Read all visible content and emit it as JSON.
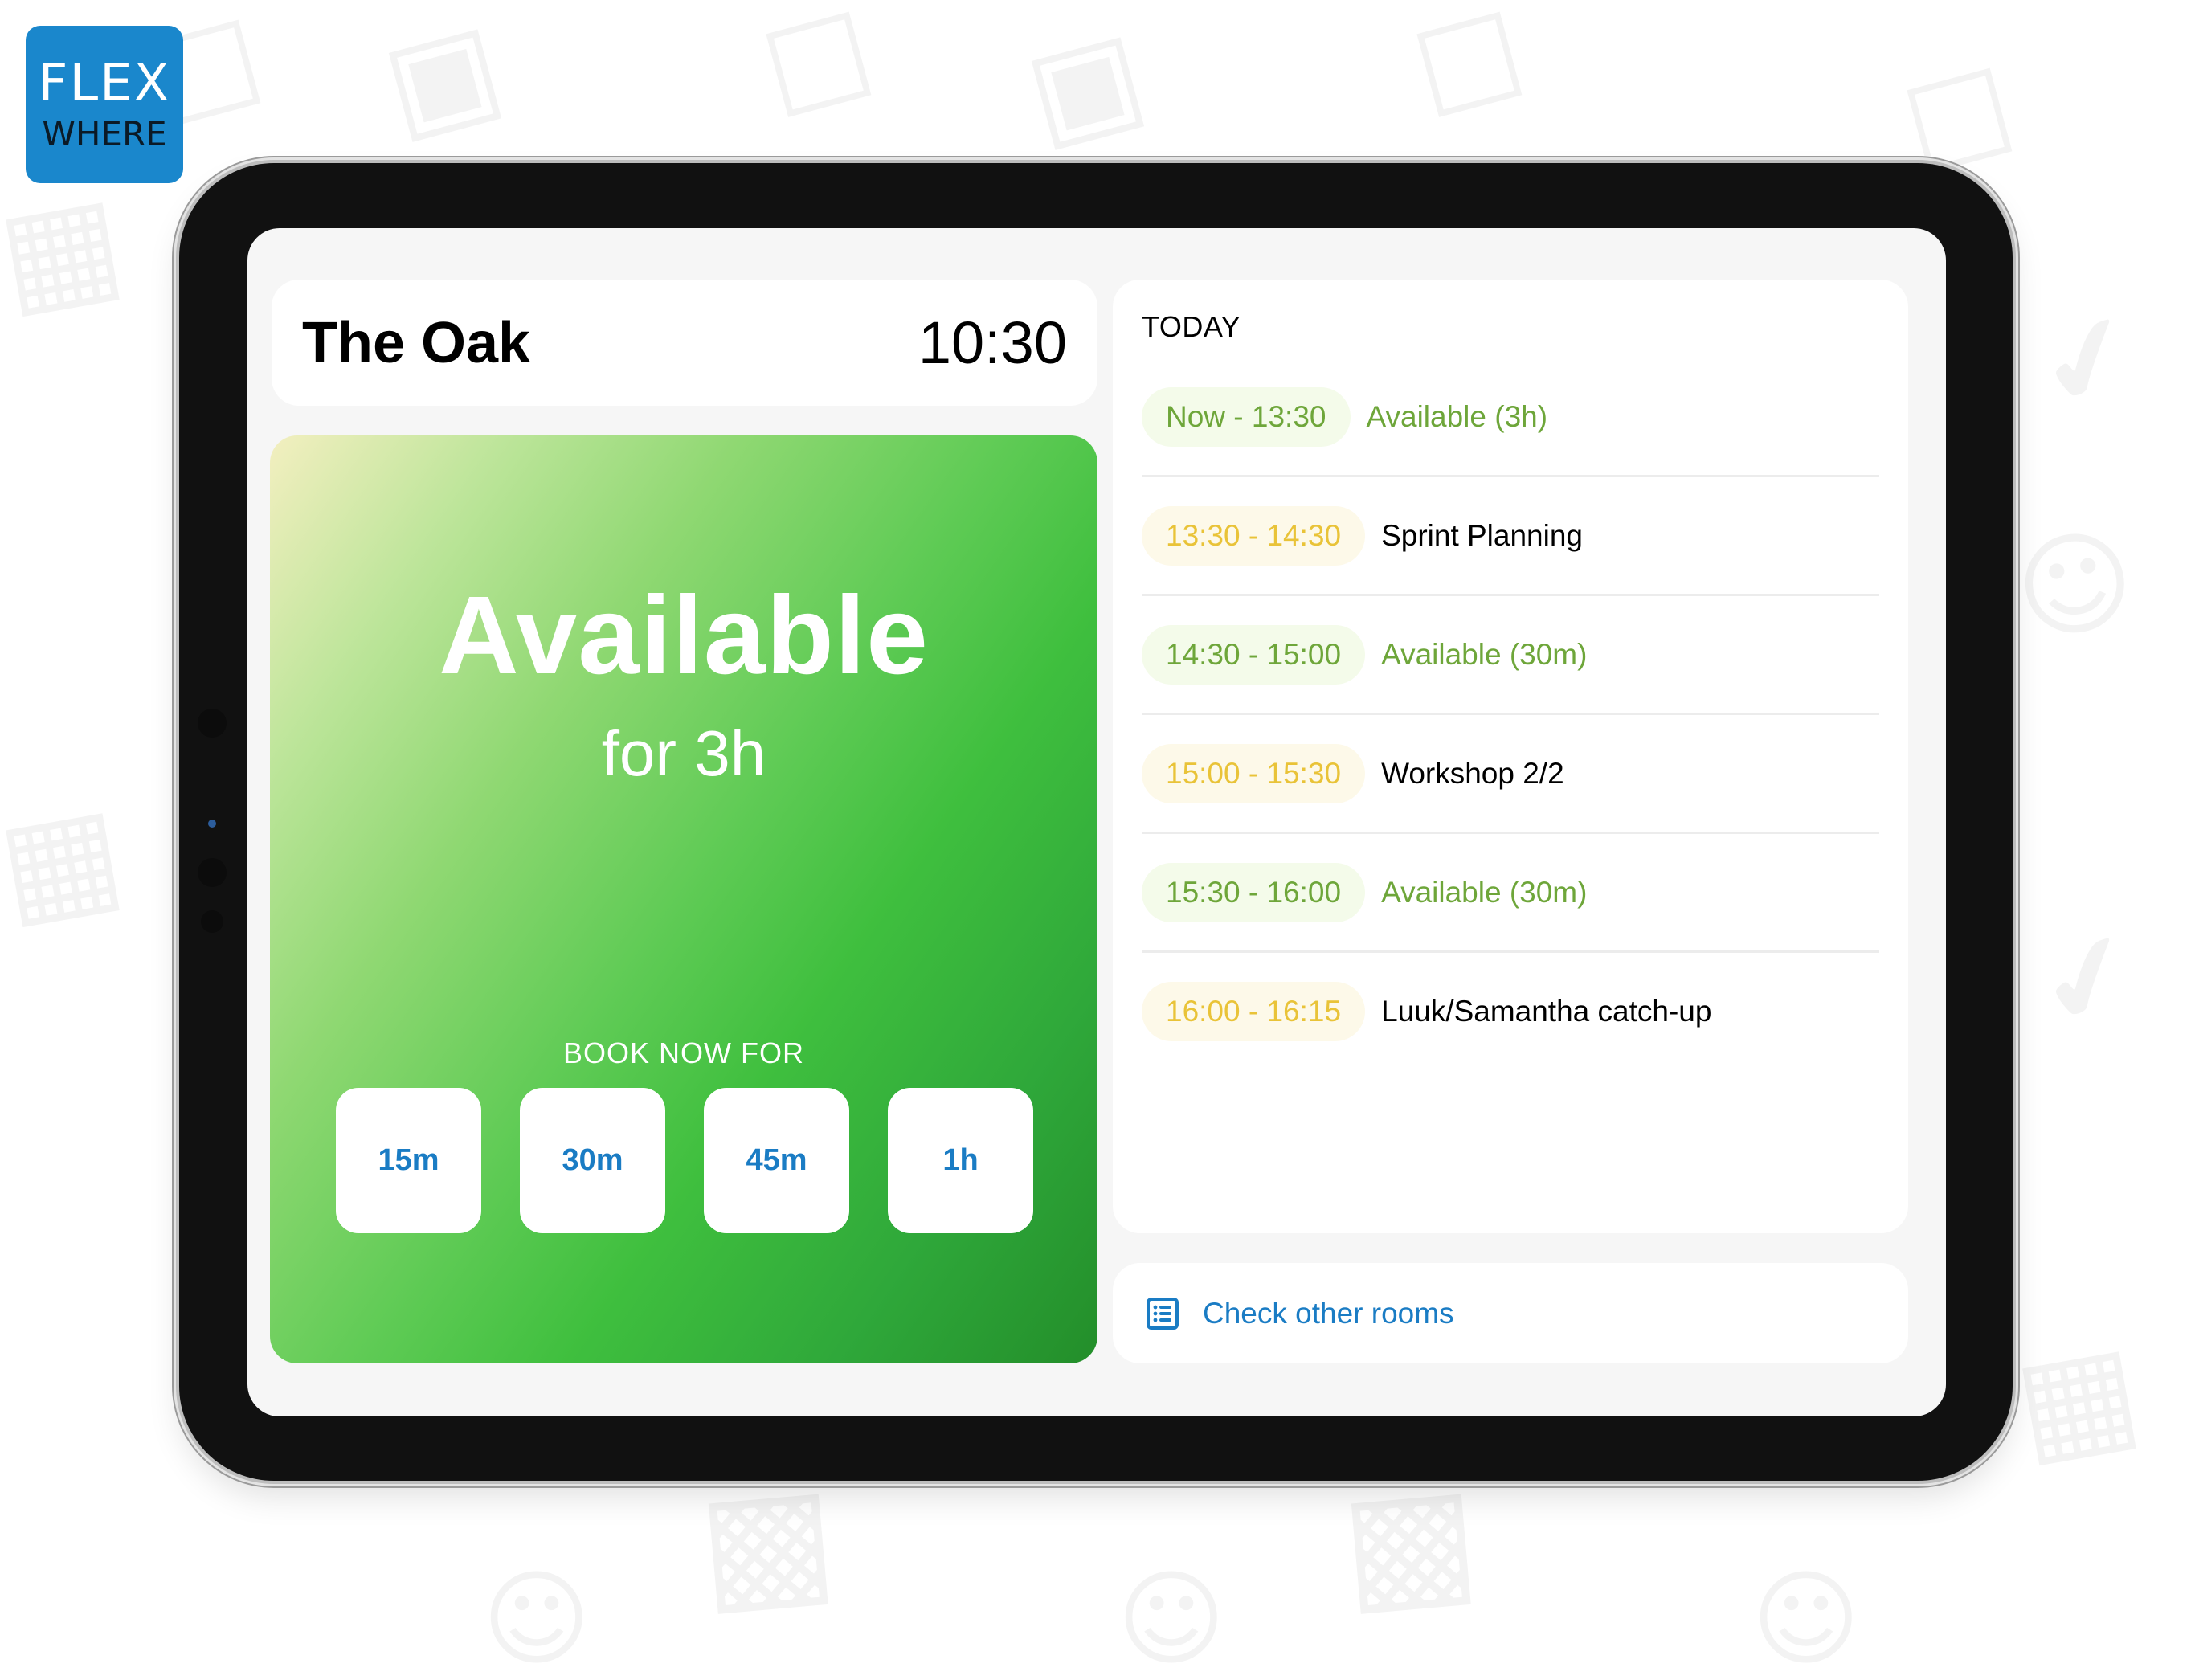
{
  "brand": {
    "name_line1": "FLEX",
    "name_line2": "WHERE",
    "color": "#1a87cc"
  },
  "header": {
    "room_name": "The Oak",
    "current_time": "10:30"
  },
  "status": {
    "state": "Available",
    "duration": "for 3h",
    "color": "#3fbf3e",
    "book_label": "BOOK NOW FOR",
    "book_options": [
      "15m",
      "30m",
      "45m",
      "1h"
    ]
  },
  "schedule": {
    "heading": "TODAY",
    "colors": {
      "available": "#6ea63a",
      "booked": "#e9c338"
    },
    "slots": [
      {
        "time": "Now - 13:30",
        "label": "Available (3h)",
        "type": "free"
      },
      {
        "time": "13:30 - 14:30",
        "label": "Sprint Planning",
        "type": "busy"
      },
      {
        "time": "14:30 - 15:00",
        "label": "Available (30m)",
        "type": "free"
      },
      {
        "time": "15:00 - 15:30",
        "label": "Workshop 2/2",
        "type": "busy"
      },
      {
        "time": "15:30 - 16:00",
        "label": "Available (30m)",
        "type": "free"
      },
      {
        "time": "16:00 - 16:15",
        "label": "Luuk/Samantha catch-up",
        "type": "busy"
      }
    ]
  },
  "footer": {
    "check_rooms_label": "Check other rooms",
    "check_rooms_icon": "list-icon"
  },
  "background_icons": [
    "chair-icon",
    "monitor-icon",
    "calendar-icon",
    "checkmark-icon",
    "people-icon",
    "building-icon"
  ]
}
